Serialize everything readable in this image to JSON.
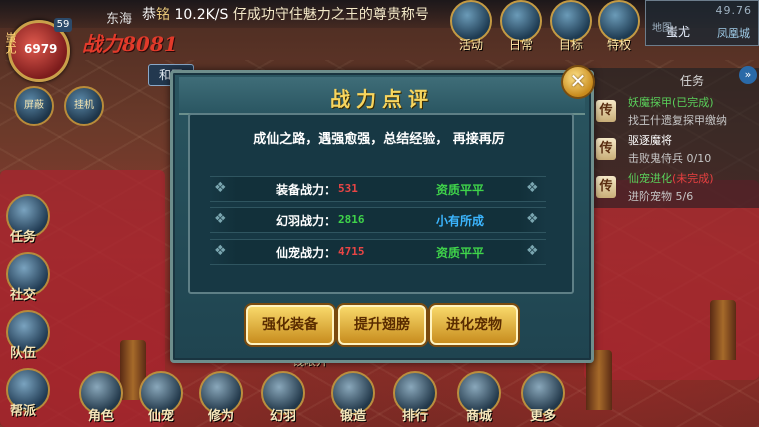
{
  "status_bar": {
    "speed": "10.2K/S",
    "message_prefix": "恭",
    "message_partial": "铭",
    "message": "仔成功守住魅力之王的尊贵称号"
  },
  "player": {
    "hp": "6979",
    "level": "59",
    "name": "蚩尤",
    "map_name": "东海",
    "power_text": "战力8081",
    "mode_label": "和平"
  },
  "left_circle_buttons": [
    {
      "label": "屏蔽"
    },
    {
      "label": "挂机"
    }
  ],
  "top_icons": [
    {
      "label": "活动",
      "icon": "activity-icon"
    },
    {
      "label": "日常",
      "icon": "daily-icon"
    },
    {
      "label": "目标",
      "icon": "target-icon"
    },
    {
      "label": "特权",
      "icon": "privilege-icon"
    }
  ],
  "minimap": {
    "map_label": "地图",
    "coords": "49.76",
    "zone": "蚩尤",
    "city": "凤凰城"
  },
  "tasks": {
    "title": "任务",
    "toggle": "»",
    "entries": [
      {
        "tag": "传",
        "text": "妖魔探甲",
        "status": "(已完成)",
        "color": "#5ad05a",
        "status_color": "#5ad05a"
      },
      {
        "tag": "",
        "text": "找王什遗复探甲缴纳",
        "status": "",
        "color": "#c6c6c6",
        "status_color": ""
      },
      {
        "tag": "传",
        "text": "驱逐魔将",
        "status": "",
        "color": "#ffffff",
        "status_color": ""
      },
      {
        "tag": "",
        "text": "击败鬼侍兵 0/10",
        "status": "",
        "color": "#c6c6c6",
        "status_color": ""
      },
      {
        "tag": "传",
        "text": "仙宠进化",
        "status": "(未完成)",
        "color": "#5ad05a",
        "status_color": "#e84040"
      },
      {
        "tag": "",
        "text": "进阶宠物 5/6",
        "status": "",
        "color": "#c6c6c6",
        "status_color": ""
      }
    ]
  },
  "side_menu": [
    {
      "label": "任务",
      "icon": "quest-icon"
    },
    {
      "label": "社交",
      "icon": "social-icon"
    },
    {
      "label": "队伍",
      "icon": "team-icon"
    },
    {
      "label": "帮派",
      "icon": "guild-icon"
    }
  ],
  "bottom_menu": [
    {
      "label": "角色",
      "icon": "character-icon"
    },
    {
      "label": "仙宠",
      "icon": "pet-icon"
    },
    {
      "label": "修为",
      "icon": "cultivation-icon"
    },
    {
      "label": "幻羽",
      "icon": "wing-icon"
    },
    {
      "label": "锻造",
      "icon": "forge-icon"
    },
    {
      "label": "排行",
      "icon": "ranking-icon"
    },
    {
      "label": "商城",
      "icon": "shop-icon"
    },
    {
      "label": "更多",
      "icon": "more-icon"
    }
  ],
  "money_label": "钱眼开",
  "dialog": {
    "title": "战力点评",
    "close": "✕",
    "motto": "成仙之路，遇强愈强，总结经验， 再接再厉",
    "stats": [
      {
        "label": "装备战力：",
        "value": "531",
        "value_color": "#e84545",
        "grade": "资质平平",
        "grade_color": "#3fd34a"
      },
      {
        "label": "幻羽战力：",
        "value": "2816",
        "value_color": "#3fd34a",
        "grade": "小有所成",
        "grade_color": "#3cb6ff"
      },
      {
        "label": "仙宠战力：",
        "value": "4715",
        "value_color": "#e84545",
        "grade": "资质平平",
        "grade_color": "#3fd34a"
      }
    ],
    "buttons": [
      {
        "label": "强化装备"
      },
      {
        "label": "提升翅膀"
      },
      {
        "label": "进化宠物"
      }
    ]
  }
}
